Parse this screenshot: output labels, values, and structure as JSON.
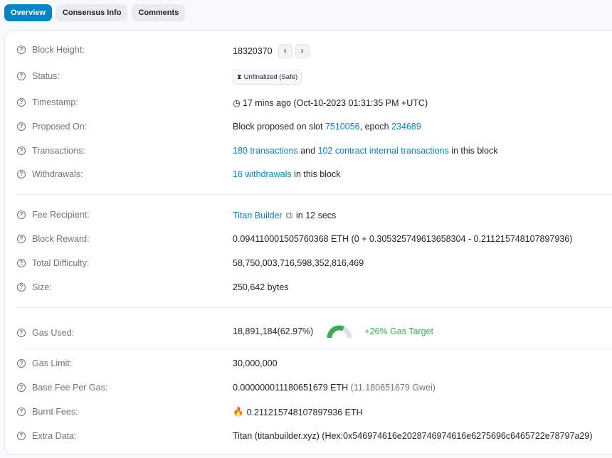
{
  "tabs": [
    {
      "label": "Overview"
    },
    {
      "label": "Consensus Info"
    },
    {
      "label": "Comments"
    }
  ],
  "rows": {
    "block_height": {
      "label": "Block Height:",
      "value": "18320370",
      "prev": "‹",
      "next": "›"
    },
    "status": {
      "label": "Status:",
      "icon_glyph": "⧗",
      "value": "Unfinalized (Safe)"
    },
    "timestamp": {
      "label": "Timestamp:",
      "icon_glyph": "◷",
      "value": "17 mins ago (Oct-10-2023 01:31:35 PM +UTC)"
    },
    "proposed_on": {
      "label": "Proposed On:",
      "prefix": "Block proposed on slot",
      "slot": "7510056",
      "mid": ", epoch",
      "epoch": "234689"
    },
    "transactions": {
      "label": "Transactions:",
      "tx_link": "180 transactions",
      "and": "and",
      "internal_link": "102 contract internal transactions",
      "suffix": "in this block"
    },
    "withdrawals": {
      "label": "Withdrawals:",
      "link": "16 withdrawals",
      "suffix": "in this block"
    },
    "fee_recipient": {
      "label": "Fee Recipient:",
      "link": "Titan Builder",
      "copy_glyph": "⧉",
      "suffix": "in 12 secs"
    },
    "block_reward": {
      "label": "Block Reward:",
      "value": "0.094110001505760368 ETH (0 + 0.305325749613658304 - 0.211215748107897936)"
    },
    "total_difficulty": {
      "label": "Total Difficulty:",
      "value": "58,750,003,716,598,352,816,469"
    },
    "size": {
      "label": "Size:",
      "value": "250,642 bytes"
    },
    "gas_used": {
      "label": "Gas Used:",
      "value": "18,891,184",
      "percent": "(62.97%)",
      "gauge_fraction": 0.6297,
      "target": "+26% Gas Target"
    },
    "gas_limit": {
      "label": "Gas Limit:",
      "value": "30,000,000"
    },
    "base_fee": {
      "label": "Base Fee Per Gas:",
      "value": "0.000000011180651679 ETH",
      "gwei": "(11.180651679 Gwei)"
    },
    "burnt_fees": {
      "label": "Burnt Fees:",
      "flame_glyph": "🔥",
      "value": "0.211215748107897936 ETH"
    },
    "extra_data": {
      "label": "Extra Data:",
      "value": "Titan (titanbuilder.xyz) (Hex:0x546974616e2028746974616e6275696c6465722e78797a29)"
    }
  },
  "colors": {
    "accent": "#0784c3",
    "gas_green": "#3cab59",
    "gauge_bg": "#dee2e6"
  }
}
